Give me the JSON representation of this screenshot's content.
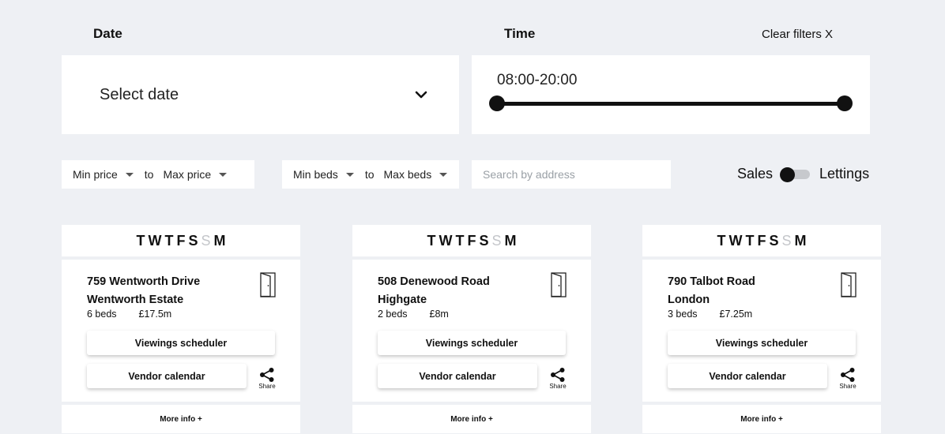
{
  "filters": {
    "date_label": "Date",
    "time_label": "Time",
    "clear_label": "Clear filters X",
    "date_value": "Select date",
    "time_value": "08:00-20:00",
    "price": {
      "min": "Min price",
      "to": "to",
      "max": "Max price"
    },
    "beds": {
      "min": "Min beds",
      "to": "to",
      "max": "Max beds"
    },
    "search_placeholder": "Search by address",
    "toggle": {
      "left": "Sales",
      "right": "Lettings"
    }
  },
  "card_common": {
    "days": [
      "T",
      "W",
      "T",
      "F",
      "S",
      "S",
      "M"
    ],
    "viewings_label": "Viewings scheduler",
    "vendor_label": "Vendor calendar",
    "share_label": "Share",
    "more_label": "More info +",
    "icons": {
      "door": "door-icon",
      "share": "share-icon",
      "dropdown": "chevron-down-icon"
    }
  },
  "cards": [
    {
      "line1": "759 Wentworth Drive",
      "line2": "Wentworth Estate",
      "beds": "6 beds",
      "price": "£17.5m"
    },
    {
      "line1": "508 Denewood Road",
      "line2": "Highgate",
      "beds": "2 beds",
      "price": "£8m"
    },
    {
      "line1": "790 Talbot Road",
      "line2": "London",
      "beds": "3 beds",
      "price": "£7.25m"
    }
  ]
}
